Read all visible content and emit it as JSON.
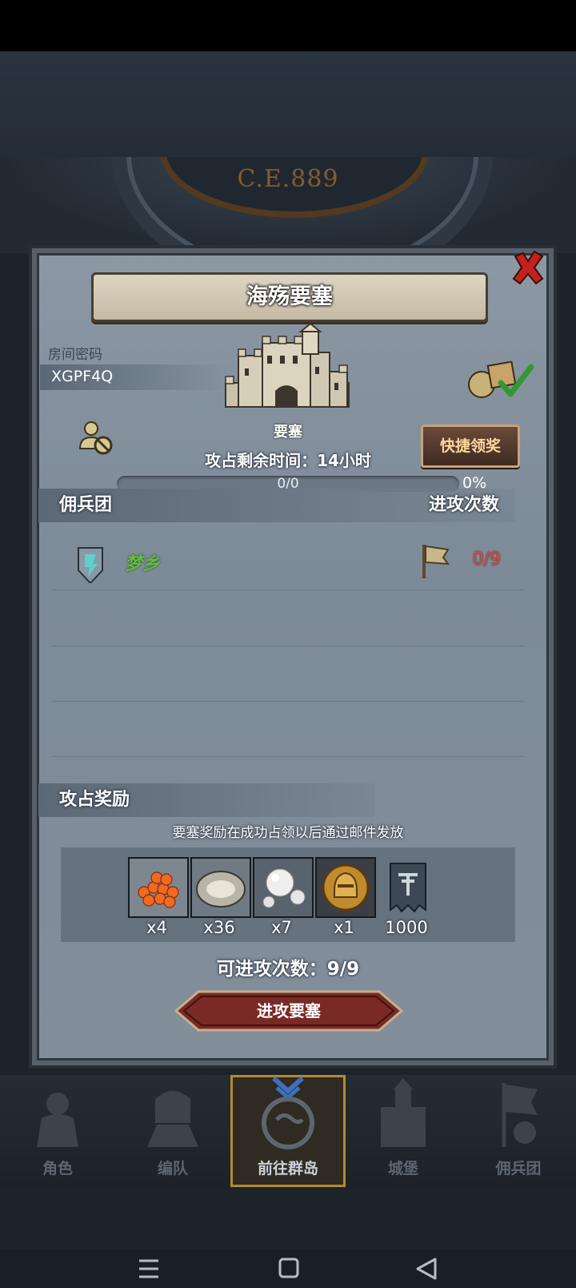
{
  "header": {
    "era": "C.E.889"
  },
  "dialog": {
    "title": "海殇要塞",
    "room_label": "房间密码",
    "room_code": "XGPF4Q",
    "fortress_label": "要塞",
    "quick_claim": "快捷领奖",
    "time_remaining": "攻占剩余时间：14小时",
    "progress_text": "0/0",
    "progress_percent": "0%",
    "progress_value": 0
  },
  "mercenary_section": {
    "title": "佣兵团",
    "right_title": "进攻次数",
    "rows": [
      {
        "name": "梦乡",
        "attacks": "0/9"
      }
    ]
  },
  "rewards_section": {
    "title": "攻占奖励",
    "note": "要塞奖励在成功占领以后通过邮件发放",
    "items": [
      {
        "icon": "roe-icon",
        "count": "x4"
      },
      {
        "icon": "oyster-icon",
        "count": "x36"
      },
      {
        "icon": "pearl-icon",
        "count": "x7"
      },
      {
        "icon": "knight-medal-icon",
        "count": "x1"
      },
      {
        "icon": "banner-icon",
        "count": "1000"
      }
    ]
  },
  "attempts": "可进攻次数：9/9",
  "attack_button": "进攻要塞",
  "bottom_nav": {
    "items": [
      {
        "label": "角色",
        "icon": "character-icon"
      },
      {
        "label": "编队",
        "icon": "formation-icon"
      },
      {
        "label": "前往群岛",
        "icon": "islands-icon",
        "active": true
      },
      {
        "label": "城堡",
        "icon": "castle-icon"
      },
      {
        "label": "佣兵团",
        "icon": "mercenary-icon"
      }
    ]
  },
  "colors": {
    "accent_gold": "#c9a24d",
    "guild_green": "#5fbf3f",
    "count_red": "#d84a3a",
    "button_red": "#7a2a25"
  }
}
